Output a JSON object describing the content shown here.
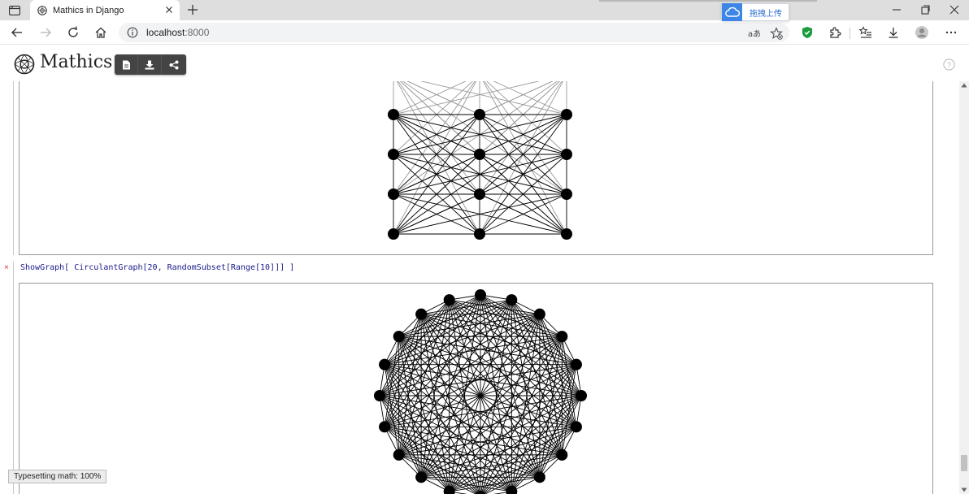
{
  "browser": {
    "tab_title": "Mathics in Django",
    "url_host": "localhost",
    "url_port": ":8000",
    "cloud_popup_label": "拖拽上传",
    "icons": [
      "tab-actions-icon",
      "mathics-favicon",
      "close-icon",
      "plus-icon",
      "back-icon",
      "forward-icon",
      "refresh-icon",
      "home-icon",
      "info-icon",
      "read-aloud-icon",
      "favorite-icon",
      "shield-icon",
      "extensions-icon",
      "collections-icon",
      "download-icon",
      "profile-icon",
      "more-icon",
      "minimize-icon",
      "maximize-icon",
      "close-window-icon",
      "cloud-upload-icon"
    ]
  },
  "app": {
    "brand": "Mathics",
    "toolbar": {
      "new_label": "new",
      "download_label": "download",
      "share_label": "share"
    },
    "cell": {
      "marker": "×",
      "input": "ShowGraph[ CirculantGraph[20, RandomSubset[Range[10]]] ]"
    },
    "status": "Typesetting math: 100%"
  },
  "graphs": {
    "grid": {
      "columns": 3,
      "rows": 5,
      "node_color": "#000000",
      "faded_row_color": "#bdbdbd"
    },
    "circulant": {
      "n": 20,
      "offsets": [
        1,
        3,
        4,
        5,
        6,
        7,
        8,
        9,
        10
      ],
      "node_color": "#000000"
    }
  }
}
